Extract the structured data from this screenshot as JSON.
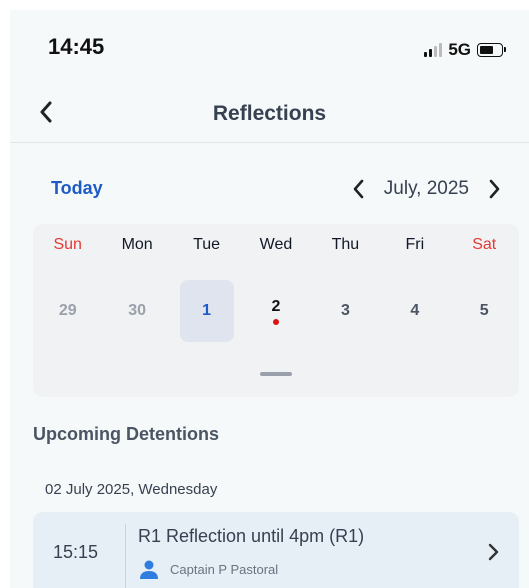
{
  "status_bar": {
    "time": "14:45",
    "network": "5G",
    "signal_bars_on": 2,
    "signal_bars_total": 4
  },
  "nav": {
    "title": "Reflections"
  },
  "calendar": {
    "today_label": "Today",
    "month_label": "July, 2025",
    "weekdays": [
      "Sun",
      "Mon",
      "Tue",
      "Wed",
      "Thu",
      "Fri",
      "Sat"
    ],
    "days": [
      {
        "label": "29",
        "state": "muted"
      },
      {
        "label": "30",
        "state": "muted"
      },
      {
        "label": "1",
        "state": "selected"
      },
      {
        "label": "2",
        "state": "event"
      },
      {
        "label": "3",
        "state": "normal"
      },
      {
        "label": "4",
        "state": "normal"
      },
      {
        "label": "5",
        "state": "normal"
      }
    ]
  },
  "upcoming": {
    "section_title": "Upcoming Detentions",
    "date_heading": "02 July 2025, Wednesday",
    "items": [
      {
        "time": "15:15",
        "title": "R1 Reflection until 4pm (R1)",
        "staff": "Captain P Pastoral"
      }
    ]
  },
  "colors": {
    "accent": "#1e5bc6",
    "weekend": "#e53935",
    "event_dot": "#dd1111",
    "card_bg": "#e6eef6"
  }
}
